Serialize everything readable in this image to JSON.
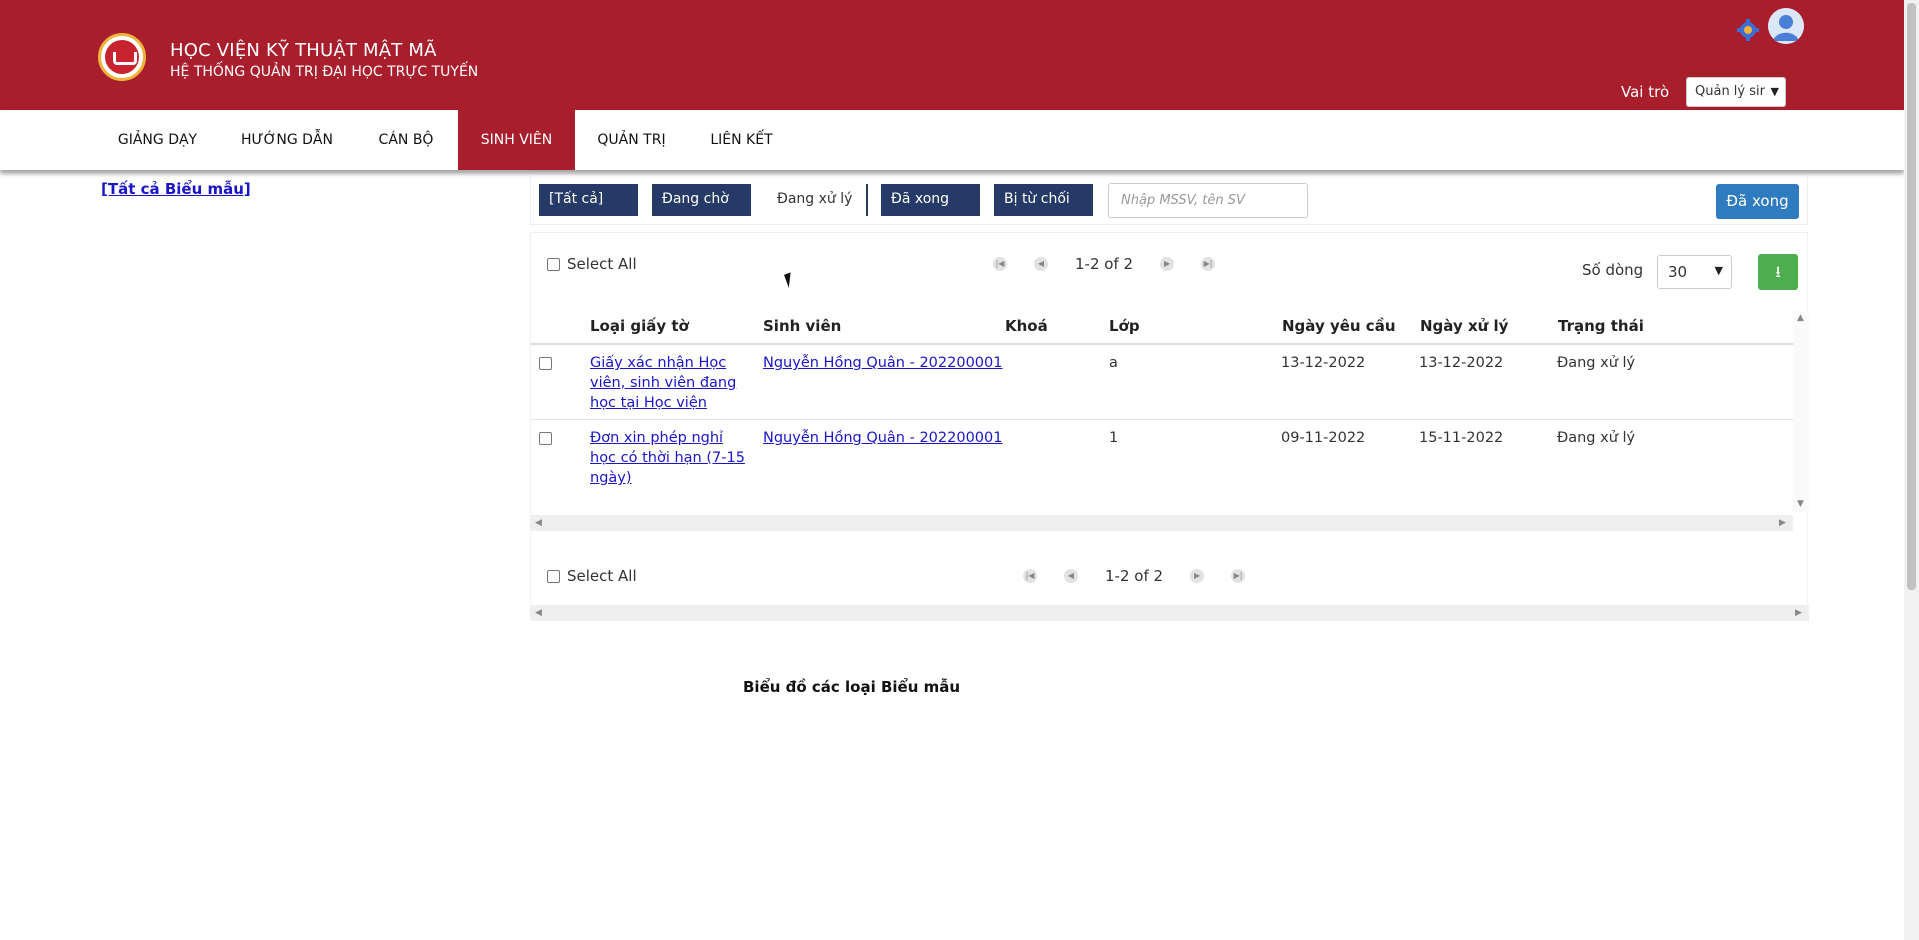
{
  "header": {
    "title": "HỌC VIỆN KỸ THUẬT MẬT MÃ",
    "subtitle": "HỆ THỐNG QUẢN TRỊ ĐẠI HỌC TRỰC TUYẾN",
    "role_label": "Vai trò",
    "role_value": "Quản lý sir",
    "accent_color": "#a81e2c"
  },
  "nav": {
    "items": [
      {
        "label": "GIẢNG DẠY"
      },
      {
        "label": "HƯỚNG DẪN"
      },
      {
        "label": "CÁN BỘ"
      },
      {
        "label": "SINH VIÊN",
        "active": true
      },
      {
        "label": "QUẢN TRỊ"
      },
      {
        "label": "LIÊN KẾT"
      }
    ]
  },
  "sidebar": {
    "all_forms_link": "[Tất cả Biểu mẫu]"
  },
  "filters": {
    "all": "[Tất cả]",
    "pending": "Đang chờ",
    "processing": "Đang xử lý",
    "done": "Đã xong",
    "rejected": "Bị từ chối",
    "search_placeholder": "Nhập MSSV, tên SV",
    "done_button": "Đã xong"
  },
  "table": {
    "select_all": "Select All",
    "pager_text": "1-2 of 2",
    "rows_label": "Số dòng",
    "rows_value": "30",
    "columns": [
      "Loại giấy tờ",
      "Sinh viên",
      "Khoá",
      "Lớp",
      "Ngày yêu cầu",
      "Ngày xử lý",
      "Trạng thái"
    ],
    "rows": [
      {
        "doc_type": "Giấy xác nhận Học viên, sinh viên đang học tại Học viện",
        "student": "Nguyễn Hồng Quân - 202200001",
        "course": "",
        "class": "a",
        "request_date": "13-12-2022",
        "process_date": "13-12-2022",
        "status": "Đang xử lý"
      },
      {
        "doc_type": "Đơn xin phép nghỉ học có thời hạn (7-15 ngày)",
        "student": "Nguyễn Hồng Quân - 202200001",
        "course": "",
        "class": "1",
        "request_date": "09-11-2022",
        "process_date": "15-11-2022",
        "status": "Đang xử lý"
      }
    ]
  },
  "chart_section": {
    "title": "Biểu đồ các loại Biểu mẫu"
  }
}
